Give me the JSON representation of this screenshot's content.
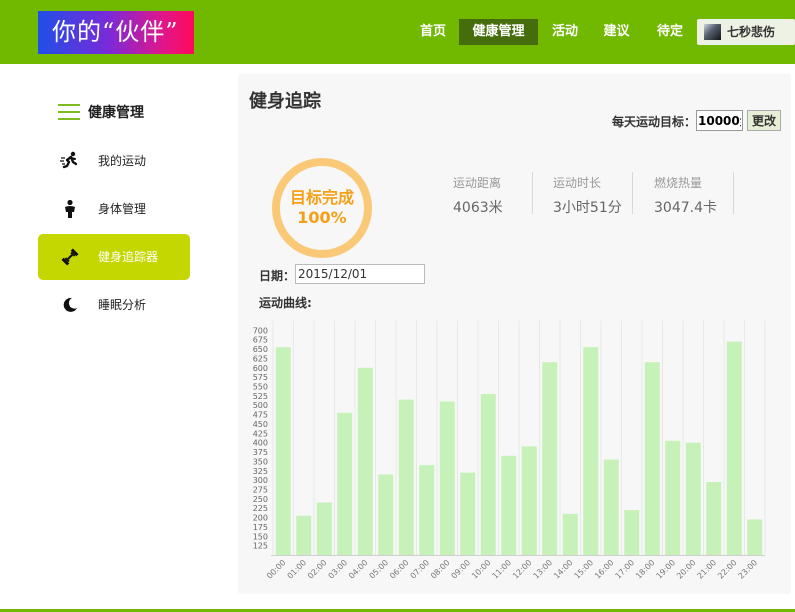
{
  "header": {
    "logo_text": "你的“伙伴”",
    "nav": [
      "首页",
      "健康管理",
      "活动",
      "建议",
      "待定"
    ],
    "active_nav": "健康管理",
    "user_name": "七秒悲伤",
    "brand_color": "#71b800"
  },
  "sidebar": {
    "title": "健康管理",
    "items": [
      {
        "label": "我的运动",
        "icon": "running-person-icon"
      },
      {
        "label": "身体管理",
        "icon": "person-icon"
      },
      {
        "label": "健身追踪器",
        "icon": "dumbbell-icon",
        "active": true
      },
      {
        "label": "睡眠分析",
        "icon": "moon-sleep-icon"
      }
    ],
    "active_color": "#c4d700"
  },
  "main": {
    "title": "健身追踪",
    "goal": {
      "label": "每天运动目标：",
      "value": "10000步",
      "button": "更改"
    },
    "progress": {
      "line1": "目标完成",
      "line2": "100%",
      "percent": 100
    },
    "stats": [
      {
        "label": "运动距离",
        "value": "4063米"
      },
      {
        "label": "运动时长",
        "value": "3小时51分"
      },
      {
        "label": "燃烧热量",
        "value": "3047.4卡"
      }
    ],
    "date": {
      "label": "日期：",
      "value": "2015/12/01"
    },
    "curve_label": "运动曲线:"
  },
  "chart_data": {
    "type": "bar",
    "categories": [
      "00:00",
      "01:00",
      "02:00",
      "03:00",
      "04:00",
      "05:00",
      "06:00",
      "07:00",
      "08:00",
      "09:00",
      "10:00",
      "11:00",
      "12:00",
      "13:00",
      "14:00",
      "15:00",
      "16:00",
      "17:00",
      "18:00",
      "19:00",
      "20:00",
      "21:00",
      "22:00",
      "23:00"
    ],
    "values": [
      655,
      205,
      240,
      480,
      600,
      315,
      515,
      340,
      510,
      320,
      530,
      365,
      390,
      615,
      210,
      655,
      355,
      220,
      615,
      405,
      400,
      295,
      670,
      195
    ],
    "yticks": [
      125,
      150,
      175,
      200,
      225,
      250,
      275,
      300,
      325,
      350,
      375,
      400,
      425,
      450,
      475,
      500,
      525,
      550,
      575,
      600,
      625,
      650,
      675,
      700
    ],
    "ylim": [
      100,
      710
    ],
    "bar_color": "#c6f1b8",
    "grid": true,
    "title": "",
    "xlabel": "",
    "ylabel": ""
  }
}
